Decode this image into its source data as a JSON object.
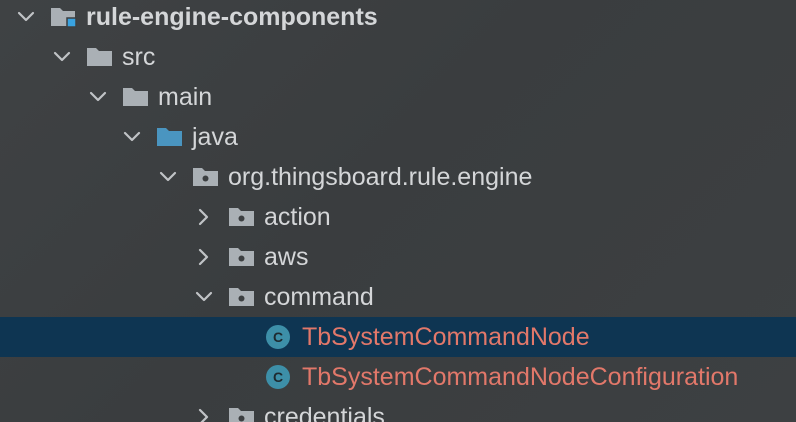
{
  "colors": {
    "background": "#3c3f41",
    "selection": "#0e3552",
    "text": "#d4d6d8",
    "error_text": "#e2786a",
    "folder": "#aab0b5",
    "source_folder": "#4a95c0",
    "class_icon": "#3d8fa8"
  },
  "tree": {
    "module": {
      "label": "rule-engine-components",
      "icon": "module-folder-icon",
      "expanded": true
    },
    "src": {
      "label": "src",
      "icon": "folder-icon",
      "expanded": true
    },
    "main": {
      "label": "main",
      "icon": "folder-icon",
      "expanded": true
    },
    "java": {
      "label": "java",
      "icon": "source-folder-icon",
      "expanded": true
    },
    "package": {
      "label": "org.thingsboard.rule.engine",
      "icon": "package-icon",
      "expanded": true
    },
    "action": {
      "label": "action",
      "icon": "package-icon",
      "expanded": false
    },
    "aws": {
      "label": "aws",
      "icon": "package-icon",
      "expanded": false
    },
    "command": {
      "label": "command",
      "icon": "package-icon",
      "expanded": true
    },
    "class1": {
      "label": "TbSystemCommandNode",
      "icon": "class-icon",
      "icon_letter": "C",
      "selected": true
    },
    "class2": {
      "label": "TbSystemCommandNodeConfiguration",
      "icon": "class-icon",
      "icon_letter": "C"
    },
    "credentials": {
      "label": "credentials",
      "icon": "package-icon",
      "expanded": false
    }
  }
}
